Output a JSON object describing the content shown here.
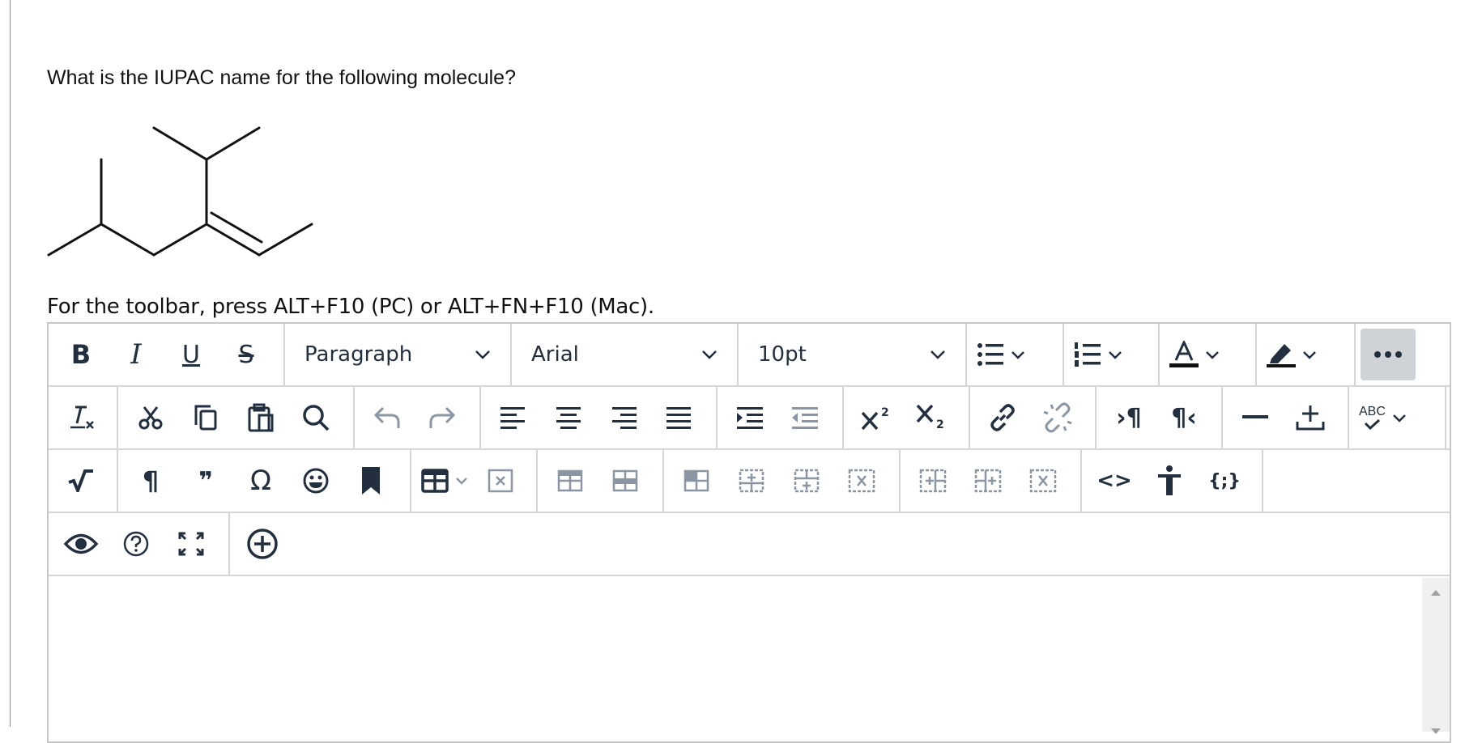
{
  "question": "What is the IUPAC name for the following molecule?",
  "toolbar_hint": "For the toolbar, press ALT+F10 (PC) or ALT+FN+F10 (Mac).",
  "dropdowns": {
    "block_format": "Paragraph",
    "font_family": "Arial",
    "font_size": "10pt"
  },
  "text_glyphs": {
    "bold": "B",
    "italic": "I",
    "underline": "U",
    "strikethrough": "S",
    "spellcheck": "ABC",
    "pilcrow": "¶",
    "quote": "❞",
    "omega": "Ω",
    "code": "<>",
    "codesample": "{;}"
  },
  "colors": {
    "icon": "#222f3e",
    "active_bg": "#cfd2d6",
    "border": "#d6d6d6"
  }
}
